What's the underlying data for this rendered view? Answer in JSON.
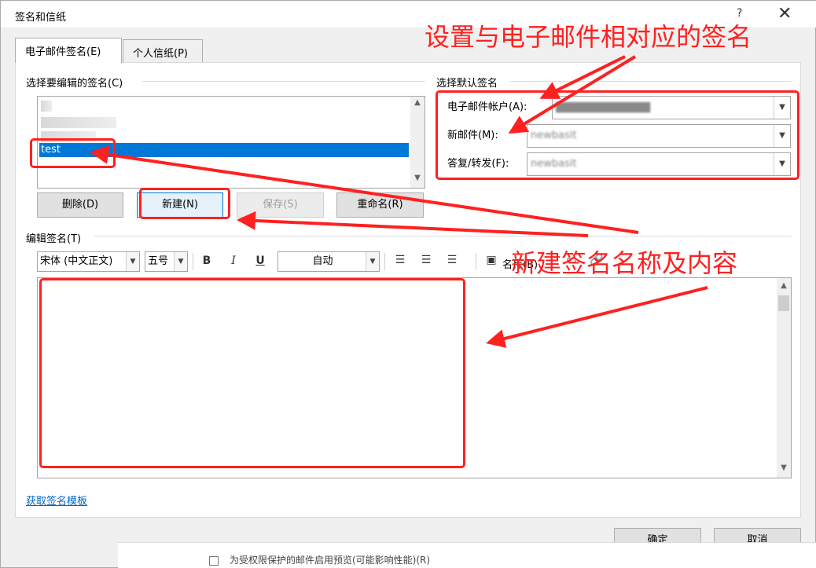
{
  "dialog": {
    "title": "签名和信纸",
    "help": "?",
    "close": "✕"
  },
  "tabs": [
    {
      "label": "电子邮件签名(E)",
      "active": true
    },
    {
      "label": "个人信纸(P)",
      "active": false
    }
  ],
  "select_signature": {
    "label": "选择要编辑的签名(C)",
    "items": [
      "test"
    ],
    "selected": "test"
  },
  "buttons": {
    "delete": "删除(D)",
    "new": "新建(N)",
    "save": "保存(S)",
    "rename": "重命名(R)"
  },
  "default_signature": {
    "label": "选择默认签名",
    "account_label": "电子邮件帐户(A):",
    "new_mail_label": "新邮件(M):",
    "reply_label": "答复/转发(F):",
    "new_mail_value": "newbasit",
    "reply_value": "newbasit"
  },
  "edit": {
    "label": "编辑签名(T)",
    "font": "宋体 (中文正文)",
    "size": "五号",
    "bold": "B",
    "italic": "I",
    "underline": "U",
    "color": "自动",
    "card_label": "名片(B)"
  },
  "template_link": "获取签名模板",
  "footer": {
    "ok": "确定",
    "cancel": "取消"
  },
  "background": {
    "text": "为受权限保护的邮件启用预览(可能影响性能)(R)"
  },
  "annotations": {
    "top": "设置与电子邮件相对应的签名",
    "middle": "新建签名名称及内容"
  },
  "colors": {
    "annotation": "#ff2020",
    "selection": "#0078d7",
    "link": "#0066cc"
  }
}
